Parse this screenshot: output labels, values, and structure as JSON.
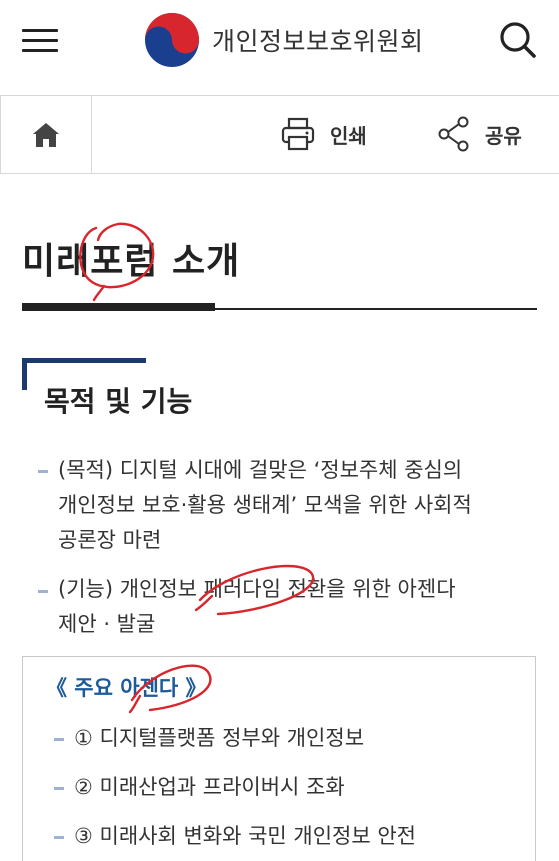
{
  "header": {
    "menu_icon": "hamburger-menu-icon",
    "org_name": "개인정보보호위원회",
    "search_icon": "search-icon"
  },
  "utility": {
    "home_icon": "home-icon",
    "print_label": "인쇄",
    "share_label": "공유"
  },
  "page": {
    "title": "미래포럼 소개"
  },
  "section": {
    "title": "목적 및 기능",
    "paragraphs": [
      {
        "lines": [
          "(목적) 디지털 시대에 걸맞은 ‘정보주체 중심의",
          "개인정보 보호·활용 생태계’ 모색을 위한 사회적",
          "공론장 마련"
        ]
      },
      {
        "lines": [
          "(기능) 개인정보 패러다임 전환을 위한 아젠다",
          "제안 · 발굴"
        ]
      }
    ]
  },
  "agenda": {
    "title": "《 주요 아젠다 》",
    "items": [
      "① 디지털플랫폼 정부와 개인정보",
      "② 미래산업과 프라이버시 조화",
      "③ 미래사회 변화와 국민 개인정보 안전"
    ]
  },
  "colors": {
    "accent_navy": "#1c3a6e",
    "agenda_blue": "#1d5a9a",
    "bullet": "#9fb3cf",
    "annotation_red": "#d9262c"
  }
}
